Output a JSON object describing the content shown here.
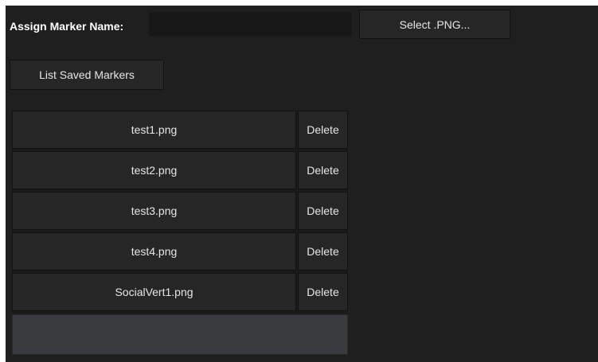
{
  "form": {
    "marker_name_label": "Assign Marker Name:",
    "marker_name_value": "",
    "select_png_label": "Select .PNG...",
    "list_saved_label": "List Saved Markers"
  },
  "markers": {
    "delete_label": "Delete",
    "items": [
      {
        "file": "test1.png"
      },
      {
        "file": "test2.png"
      },
      {
        "file": "test3.png"
      },
      {
        "file": "test4.png"
      },
      {
        "file": "SocialVert1.png"
      }
    ]
  }
}
